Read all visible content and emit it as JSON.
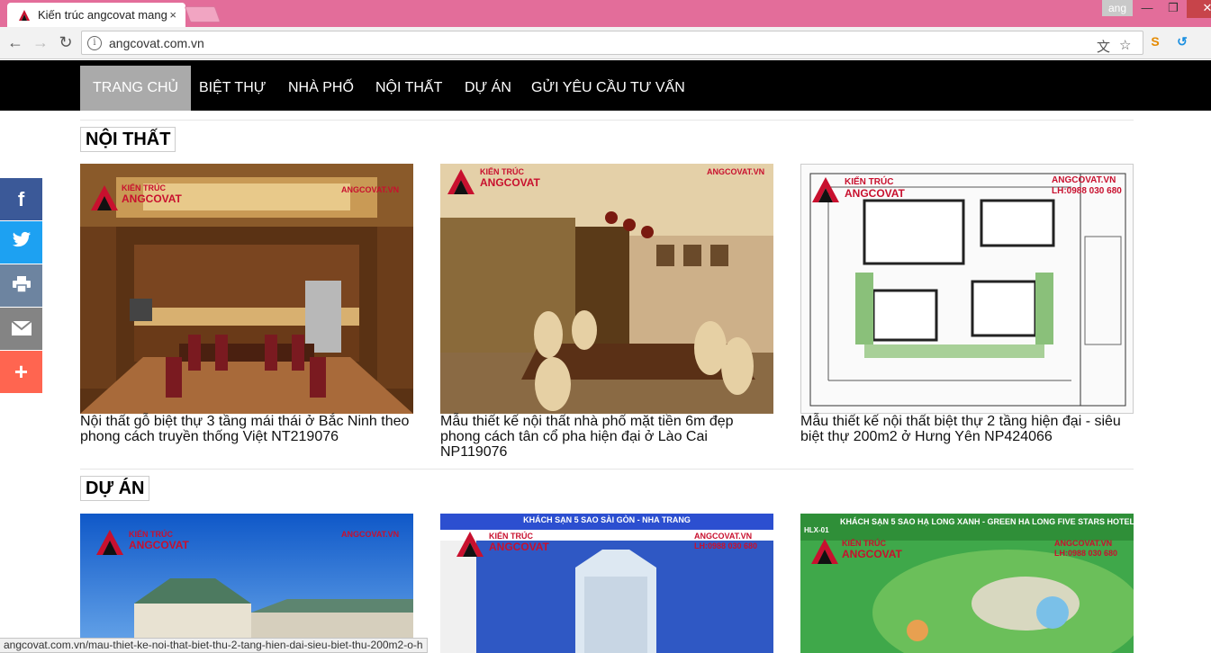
{
  "browser": {
    "tab_title": "Kiến trúc angcovat mang",
    "tab_close": "×",
    "profile": "ang",
    "url": "angcovat.com.vn",
    "status_url": "angcovat.com.vn/mau-thiet-ke-noi-that-biet-thu-2-tang-hien-dai-sieu-biet-thu-200m2-o-h"
  },
  "nav": {
    "items": [
      "TRANG CHỦ",
      "BIỆT THỰ",
      "NHÀ PHỐ",
      "NỘI THẤT",
      "DỰ ÁN",
      "GỬI YÊU CẦU TƯ VẤN"
    ]
  },
  "sections": {
    "noi_that": {
      "title": "NỘI THẤT",
      "cards": [
        {
          "caption": "Nội thất gỗ biệt thự 3 tầng mái thái ở Bắc Ninh theo phong cách truyền thống Việt NT219076"
        },
        {
          "caption": "Mẫu thiết kế nội thất nhà phố mặt tiền 6m đẹp phong cách tân cổ pha hiện đại ở Lào Cai NP119076"
        },
        {
          "caption": "Mẫu thiết kế nội thất biệt thự 2 tầng hiện đại - siêu biệt thự 200m2 ở Hưng Yên NP424066"
        }
      ]
    },
    "du_an": {
      "title": "DỰ ÁN",
      "card2_banner": "KHÁCH SẠN 5 SAO SÀI GÒN - NHA TRANG",
      "card3_banner": "KHÁCH SẠN 5 SAO HẠ LONG XANH - GREEN HA LONG FIVE STARS HOTEL",
      "card3_code": "HLX-01"
    }
  },
  "watermark": {
    "brand_line1": "KIẾN TRÚC",
    "brand_line2": "ANGCOVAT",
    "site": "ANGCOVAT.VN",
    "phone": "LH:0988 030 680"
  },
  "share_icons": [
    "facebook-icon",
    "twitter-icon",
    "print-icon",
    "email-icon",
    "plus-icon"
  ],
  "colors": {
    "titlebar": "#e36d9a",
    "facebook": "#3b5998",
    "twitter": "#1da1f2",
    "print": "#6d84a0",
    "email": "#848484",
    "plus": "#ff6550",
    "brand_red": "#c8102e"
  }
}
